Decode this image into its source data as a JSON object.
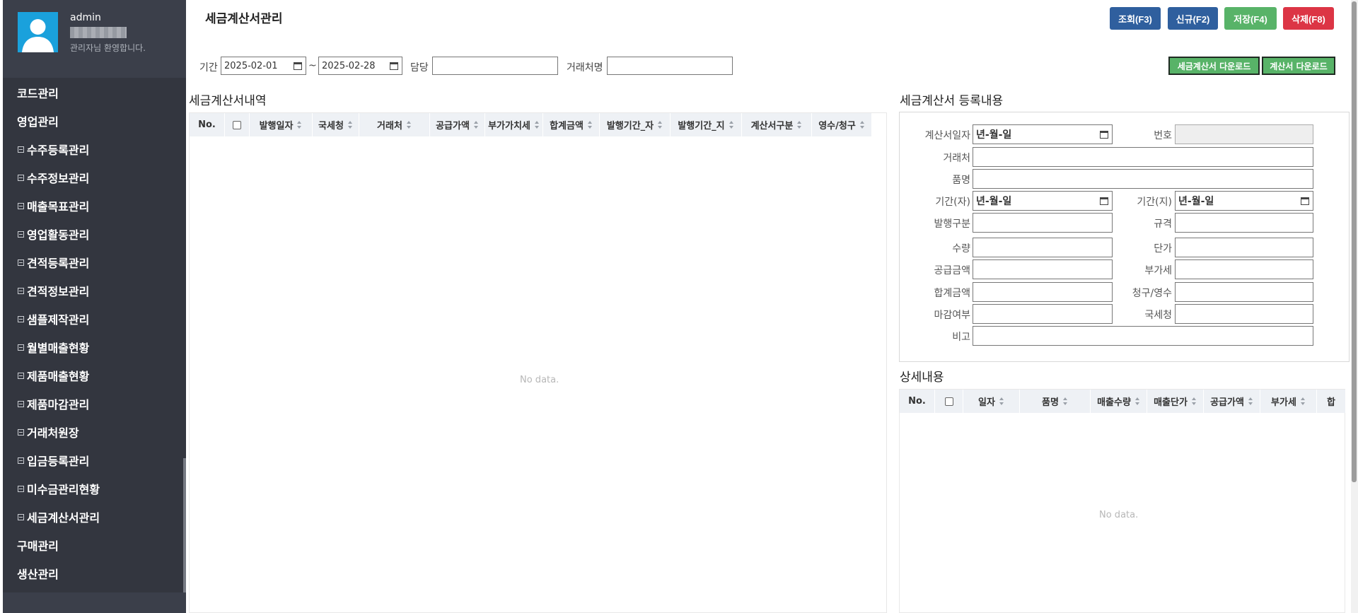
{
  "user": {
    "name": "admin",
    "welcome": "관리자님 환영합니다."
  },
  "sidebar": {
    "items": [
      {
        "label": "코드관리",
        "sub": false
      },
      {
        "label": "영업관리",
        "sub": false
      },
      {
        "label": "수주등록관리",
        "sub": true
      },
      {
        "label": "수주정보관리",
        "sub": true
      },
      {
        "label": "매출목표관리",
        "sub": true
      },
      {
        "label": "영업활동관리",
        "sub": true
      },
      {
        "label": "견적등록관리",
        "sub": true
      },
      {
        "label": "견적정보관리",
        "sub": true
      },
      {
        "label": "샘플제작관리",
        "sub": true
      },
      {
        "label": "월별매출현황",
        "sub": true
      },
      {
        "label": "제품매출현황",
        "sub": true
      },
      {
        "label": "제품마감관리",
        "sub": true
      },
      {
        "label": "거래처원장",
        "sub": true
      },
      {
        "label": "입금등록관리",
        "sub": true
      },
      {
        "label": "미수금관리현황",
        "sub": true
      },
      {
        "label": "세금계산서관리",
        "sub": true
      },
      {
        "label": "구매관리",
        "sub": false
      },
      {
        "label": "생산관리",
        "sub": false
      }
    ]
  },
  "header": {
    "title": "세금계산서관리",
    "buttons": {
      "search": "조회(F3)",
      "new": "신규(F2)",
      "save": "저장(F4)",
      "delete": "삭제(F8)"
    }
  },
  "filters": {
    "period_label": "기간",
    "date_from": "2025-02-01",
    "tilde": "~",
    "date_to": "2025-02-28",
    "manager_label": "담당",
    "customer_label": "거래처명",
    "download_tax": "세금계산서 다운로드",
    "download_invoice": "계산서 다운로드"
  },
  "list": {
    "title": "세금계산서내역",
    "columns": [
      "No.",
      "",
      "발행일자",
      "국세청",
      "거래처",
      "공급가액",
      "부가가치세",
      "합계금액",
      "발행기간_자",
      "발행기간_지",
      "계산서구분",
      "영수/청구"
    ],
    "nodata": "No data."
  },
  "form": {
    "title": "세금계산서 등록내용",
    "date_placeholder": "년-월-일",
    "labels": {
      "invoice_date": "계산서일자",
      "number": "번호",
      "customer": "거래처",
      "item": "품명",
      "period_from": "기간(자)",
      "period_to": "기간(지)",
      "issue_type": "발행구분",
      "spec": "규격",
      "qty": "수량",
      "price": "단가",
      "supply": "공급금액",
      "vat": "부가세",
      "total": "합계금액",
      "claim": "청구/영수",
      "closed": "마감여부",
      "nts": "국세청",
      "note": "비고"
    }
  },
  "detail": {
    "title": "상세내용",
    "columns": [
      "No.",
      "",
      "일자",
      "품명",
      "매출수량",
      "매출단가",
      "공급가액",
      "부가세",
      "합"
    ],
    "nodata": "No data."
  },
  "colors": {
    "blue": "#2f5f9e",
    "green": "#58b368",
    "red": "#dc3545",
    "sidebar": "#33363f"
  }
}
